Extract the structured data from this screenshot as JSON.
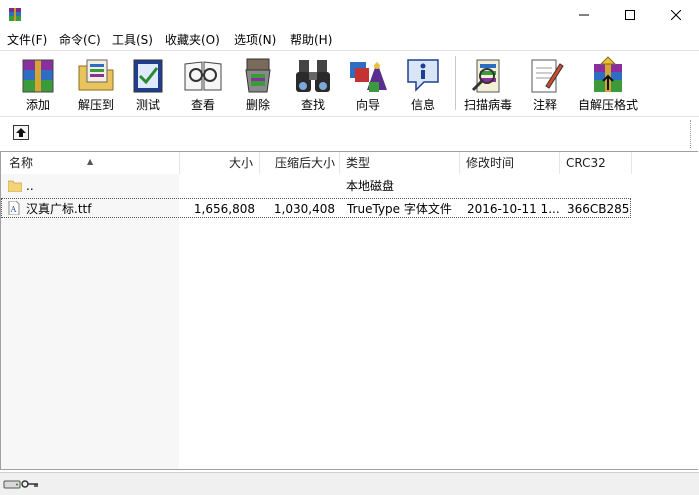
{
  "menu": [
    "文件(F)",
    "命令(C)",
    "工具(S)",
    "收藏夹(O)",
    "选项(N)",
    "帮助(H)"
  ],
  "toolbar": {
    "add": "添加",
    "extract_to": "解压到",
    "test": "测试",
    "view": "查看",
    "delete": "删除",
    "find": "查找",
    "wizard": "向导",
    "info": "信息",
    "virus_scan": "扫描病毒",
    "comment": "注释",
    "sfx": "自解压格式"
  },
  "columns": {
    "name": "名称",
    "size": "大小",
    "packed": "压缩后大小",
    "type": "类型",
    "modified": "修改时间",
    "crc": "CRC32"
  },
  "files": [
    {
      "name": "..",
      "size": "",
      "packed": "",
      "type": "本地磁盘",
      "modified": "",
      "crc": ""
    },
    {
      "name": "汉真广标.ttf",
      "size": "1,656,808",
      "packed": "1,030,408",
      "type": "TrueType 字体文件",
      "modified": "2016-10-11 1...",
      "crc": "366CB285"
    }
  ]
}
